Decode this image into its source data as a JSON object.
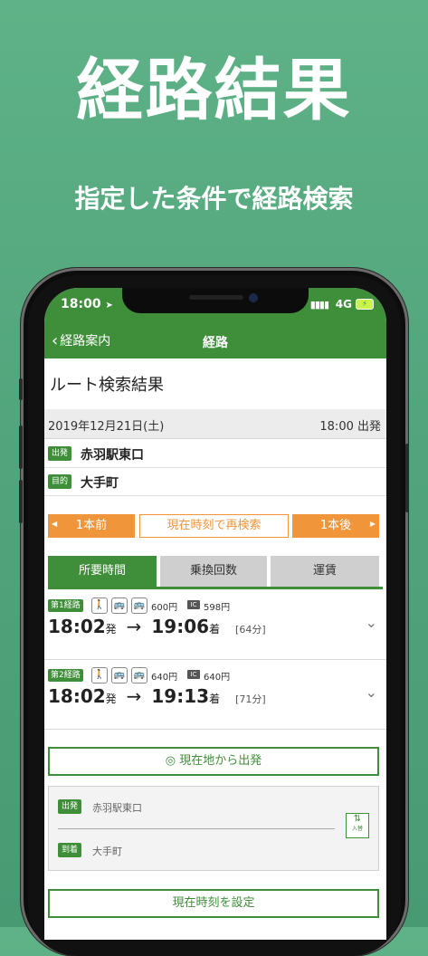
{
  "promo": {
    "title": "経路結果",
    "subtitle": "指定した条件で経路検索"
  },
  "status_bar": {
    "time": "18:00",
    "location_icon": "location-arrow-icon",
    "signal": "▮▮▮▮",
    "network": "4G",
    "battery": "⚡"
  },
  "nav": {
    "back_label": "経路案内",
    "title": "経路"
  },
  "page": {
    "heading": "ルート検索結果"
  },
  "search": {
    "date": "2019年12月21日(土)",
    "time": "18:00 出発",
    "origin_badge": "出発",
    "origin": "赤羽駅東口",
    "destination_badge": "目的",
    "destination": "大手町"
  },
  "actions": {
    "prev": "1本前",
    "research": "現在時刻で再検索",
    "next": "1本後",
    "prev_arrow": "◀",
    "next_arrow": "▶"
  },
  "tabs": [
    {
      "label": "所要時間",
      "active": true
    },
    {
      "label": "乗換回数",
      "active": false
    },
    {
      "label": "運賃",
      "active": false
    }
  ],
  "routes": [
    {
      "label": "第1経路",
      "modes": [
        "walk-icon",
        "bus-icon",
        "bus-icon"
      ],
      "fare_ticket": "600円",
      "ic_label": "IC",
      "fare_ic": "598円",
      "depart": "18:02",
      "depart_suffix": "発",
      "arrow": "→",
      "arrive": "19:06",
      "arrive_suffix": "着",
      "duration": "[64分]"
    },
    {
      "label": "第2経路",
      "modes": [
        "walk-icon",
        "bus-icon",
        "bus-icon"
      ],
      "fare_ticket": "640円",
      "ic_label": "IC",
      "fare_ic": "640円",
      "depart": "18:02",
      "depart_suffix": "発",
      "arrow": "→",
      "arrive": "19:13",
      "arrive_suffix": "着",
      "duration": "[71分]"
    }
  ],
  "form": {
    "location_button": "現在地から出発",
    "origin_badge": "出発",
    "origin": "赤羽駅東口",
    "dest_badge": "到着",
    "destination": "大手町",
    "swap_arrows": "⇅",
    "swap_label": "入替",
    "set_time_button": "現在時刻を設定"
  },
  "colors": {
    "background": "#55a87f",
    "brand_green": "#3f8e3a",
    "orange": "#f0953a"
  }
}
